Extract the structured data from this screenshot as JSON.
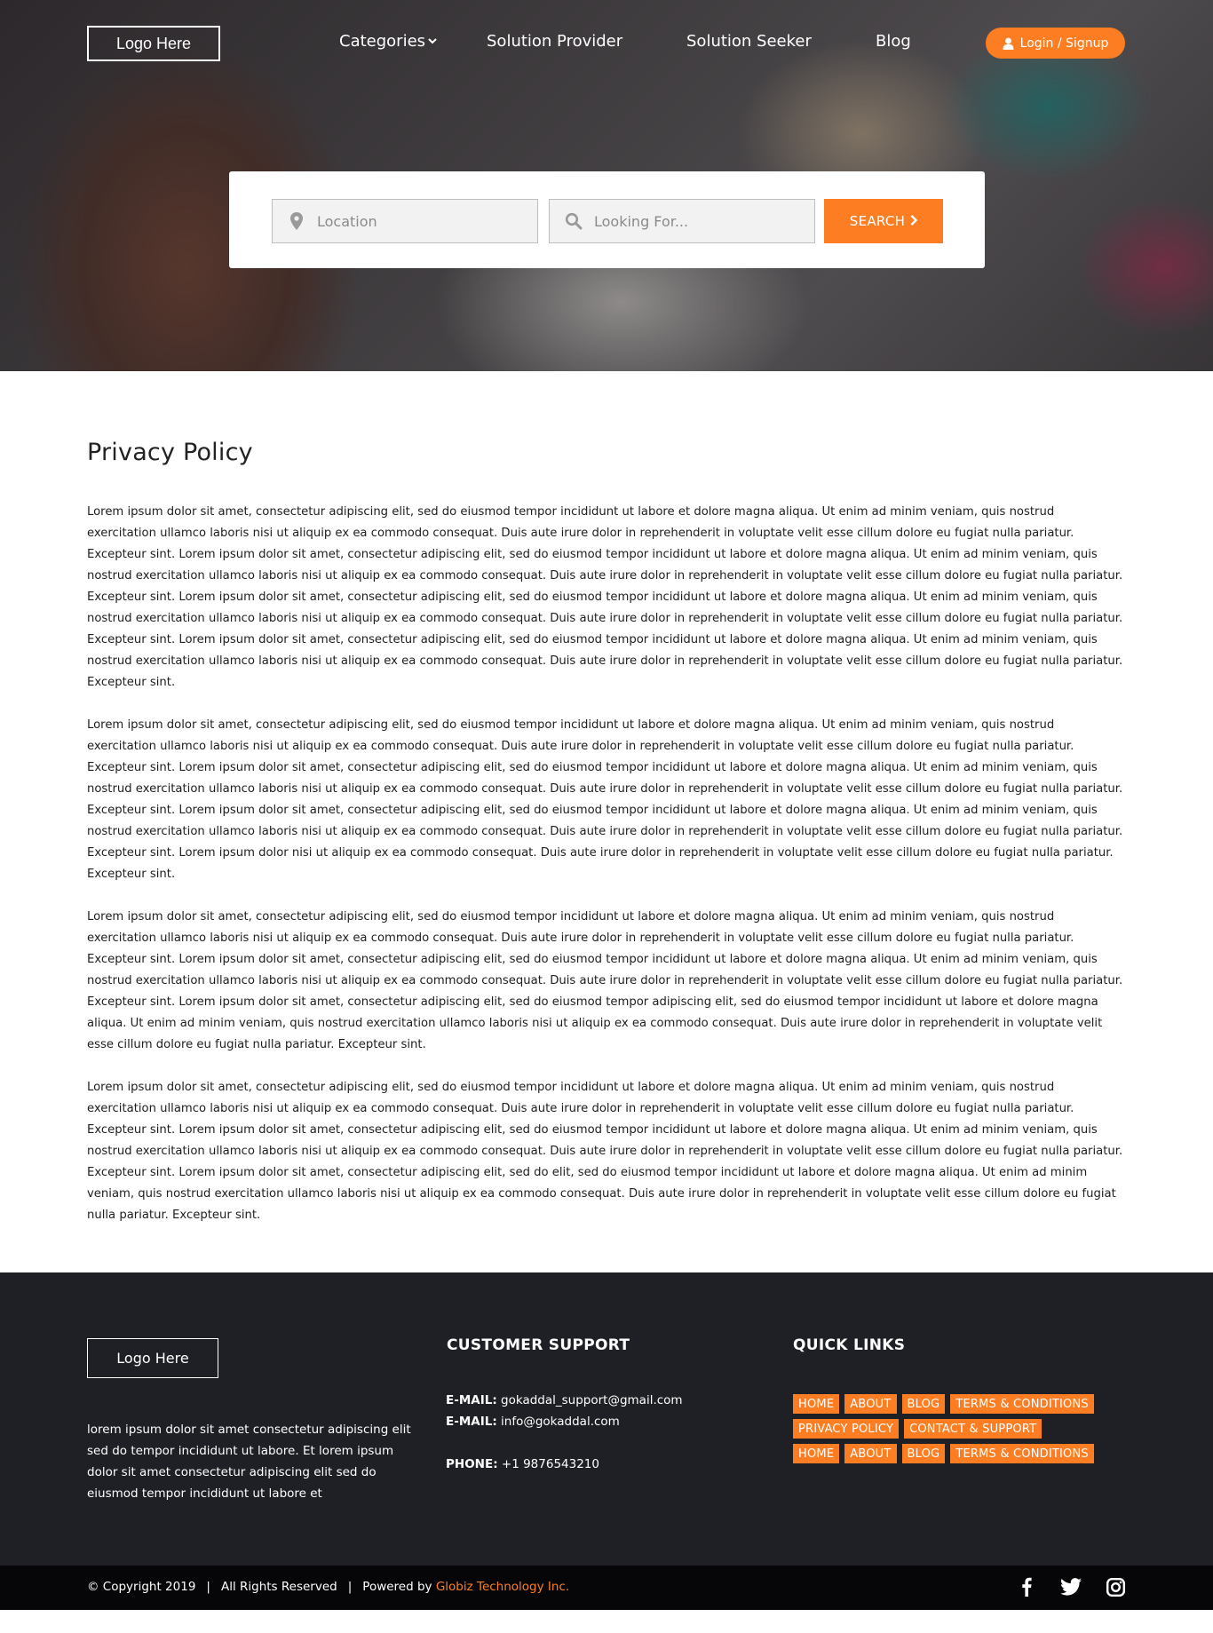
{
  "header": {
    "logo": "Logo Here",
    "nav": [
      {
        "label": "Categories"
      },
      {
        "label": "Solution Provider"
      },
      {
        "label": "Solution Seeker"
      },
      {
        "label": "Blog"
      }
    ],
    "login_label": "Login / Signup"
  },
  "search": {
    "location_placeholder": "Location",
    "looking_placeholder": "Looking For...",
    "button_label": "SEARCH"
  },
  "main": {
    "title": "Privacy Policy",
    "paragraphs": [
      "Lorem ipsum dolor sit amet, consectetur adipiscing elit, sed do eiusmod tempor incididunt ut labore et dolore magna aliqua. Ut enim ad minim veniam, quis nostrud exercitation ullamco laboris nisi ut aliquip ex ea commodo consequat. Duis aute irure dolor in reprehenderit in voluptate velit esse cillum dolore eu fugiat nulla pariatur. Excepteur sint. Lorem ipsum dolor sit amet, consectetur adipiscing elit, sed do eiusmod tempor incididunt ut labore et dolore magna aliqua. Ut enim ad minim veniam, quis nostrud exercitation ullamco laboris nisi ut aliquip ex ea commodo consequat. Duis aute irure dolor in reprehenderit in voluptate velit esse cillum dolore eu fugiat nulla pariatur. Excepteur sint. Lorem ipsum dolor sit amet, consectetur adipiscing elit, sed do eiusmod tempor incididunt ut labore et dolore magna aliqua. Ut enim ad minim veniam, quis nostrud exercitation ullamco laboris nisi ut aliquip ex ea commodo consequat. Duis aute irure dolor in reprehenderit in voluptate velit esse cillum dolore eu fugiat nulla pariatur. Excepteur sint. Lorem ipsum dolor sit amet, consectetur adipiscing elit, sed do eiusmod tempor incididunt ut labore et dolore magna aliqua. Ut enim ad minim veniam, quis nostrud exercitation ullamco laboris nisi ut aliquip ex ea commodo consequat. Duis aute irure dolor in reprehenderit in voluptate velit esse cillum dolore eu fugiat nulla pariatur. Excepteur sint.",
      "Lorem ipsum dolor sit amet, consectetur adipiscing elit, sed do eiusmod tempor incididunt ut labore et dolore magna aliqua. Ut enim ad minim veniam, quis nostrud exercitation ullamco laboris nisi ut aliquip ex ea commodo consequat. Duis aute irure dolor in reprehenderit in voluptate velit esse cillum dolore eu fugiat nulla pariatur. Excepteur sint. Lorem ipsum dolor sit amet, consectetur adipiscing elit, sed do eiusmod tempor incididunt ut labore et dolore magna aliqua. Ut enim ad minim veniam, quis nostrud exercitation ullamco laboris nisi ut aliquip ex ea commodo consequat. Duis aute irure dolor in reprehenderit in voluptate velit esse cillum dolore eu fugiat nulla pariatur. Excepteur sint. Lorem ipsum dolor sit amet, consectetur adipiscing elit, sed do eiusmod tempor incididunt ut labore et dolore magna aliqua. Ut enim ad minim veniam, quis nostrud exercitation ullamco laboris nisi ut aliquip ex ea commodo consequat. Duis aute irure dolor in reprehenderit in voluptate velit esse cillum dolore eu fugiat nulla pariatur. Excepteur sint. Lorem ipsum dolor nisi ut aliquip ex ea commodo consequat. Duis aute irure dolor in reprehenderit in voluptate velit esse cillum dolore eu fugiat nulla pariatur. Excepteur sint.",
      "Lorem ipsum dolor sit amet, consectetur adipiscing elit, sed do eiusmod tempor incididunt ut labore et dolore magna aliqua. Ut enim ad minim veniam, quis nostrud exercitation ullamco laboris nisi ut aliquip ex ea commodo consequat. Duis aute irure dolor in reprehenderit in voluptate velit esse cillum dolore eu fugiat nulla pariatur. Excepteur sint. Lorem ipsum dolor sit amet, consectetur adipiscing elit, sed do eiusmod tempor incididunt ut labore et dolore magna aliqua. Ut enim ad minim veniam, quis nostrud exercitation ullamco laboris nisi ut aliquip ex ea commodo consequat. Duis aute irure dolor in reprehenderit in voluptate velit esse cillum dolore eu fugiat nulla pariatur. Excepteur sint. Lorem ipsum dolor sit amet, consectetur adipiscing elit, sed do eiusmod tempor adipiscing elit, sed do eiusmod tempor incididunt ut labore et dolore magna aliqua. Ut enim ad minim veniam, quis nostrud exercitation ullamco laboris nisi ut aliquip ex ea commodo consequat. Duis aute irure dolor in reprehenderit in voluptate velit esse cillum dolore eu fugiat nulla pariatur. Excepteur sint.",
      "Lorem ipsum dolor sit amet, consectetur adipiscing elit, sed do eiusmod tempor incididunt ut labore et dolore magna aliqua. Ut enim ad minim veniam, quis nostrud exercitation ullamco laboris nisi ut aliquip ex ea commodo consequat. Duis aute irure dolor in reprehenderit in voluptate velit esse cillum dolore eu fugiat nulla pariatur. Excepteur sint. Lorem ipsum dolor sit amet, consectetur adipiscing elit, sed do eiusmod tempor incididunt ut labore et dolore magna aliqua. Ut enim ad minim veniam, quis nostrud exercitation ullamco laboris nisi ut aliquip ex ea commodo consequat. Duis aute irure dolor in reprehenderit in voluptate velit esse cillum dolore eu fugiat nulla pariatur. Excepteur sint. Lorem ipsum dolor sit amet, consectetur adipiscing elit, sed do elit, sed do eiusmod tempor incididunt ut labore et dolore magna aliqua. Ut enim ad minim veniam, quis nostrud exercitation ullamco laboris nisi ut aliquip ex ea commodo consequat. Duis aute irure dolor in reprehenderit in voluptate velit esse cillum dolore eu fugiat nulla pariatur. Excepteur sint."
    ]
  },
  "footer": {
    "logo": "Logo Here",
    "about": "lorem ipsum dolor sit amet consectetur adipiscing elit sed do tempor incididunt ut labore.  Et lorem ipsum dolor sit amet consectetur adipiscing elit sed do eiusmod tempor incididunt ut labore et",
    "support_heading": "CUSTOMER SUPPORT",
    "email_label": "E-MAIL:",
    "email1": "gokaddal_support@gmail.com",
    "email2": "info@gokaddal.com",
    "phone_label": "PHONE:",
    "phone": "+1 9876543210",
    "links_heading": "QUICK LINKS",
    "link_rows": [
      [
        "HOME",
        "ABOUT",
        "BLOG",
        "TERMS & CONDITIONS"
      ],
      [
        "PRIVACY POLICY",
        "CONTACT & SUPPORT"
      ],
      [
        "HOME",
        "ABOUT",
        "BLOG",
        "TERMS & CONDITIONS"
      ]
    ]
  },
  "bottom": {
    "copyright": "© Copyright 2019",
    "rights": "All Rights Reserved",
    "powered_by": "Powered by",
    "company": "Globiz Technology Inc.",
    "separator": "|"
  },
  "colors": {
    "accent": "#fd7e22",
    "footer_bg": "#1f2025",
    "bottombar_bg": "#060608"
  },
  "icons": {
    "categories_chevron": "chevron-down-icon",
    "login": "user-icon",
    "location": "map-marker-icon",
    "looking": "search-icon",
    "search_button": "chevron-right-icon",
    "social": [
      "facebook-icon",
      "twitter-icon",
      "instagram-icon"
    ]
  }
}
